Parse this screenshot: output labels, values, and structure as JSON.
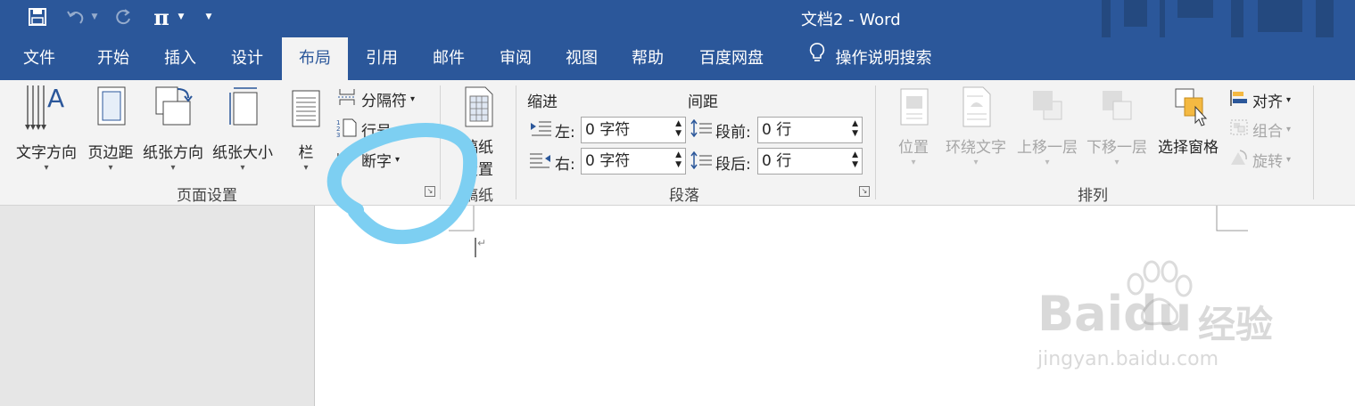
{
  "titlebar": {
    "doc_title": "文档2  -  Word"
  },
  "tabs": [
    "文件",
    "开始",
    "插入",
    "设计",
    "布局",
    "引用",
    "邮件",
    "审阅",
    "视图",
    "帮助",
    "百度网盘"
  ],
  "tell_me": "操作说明搜索",
  "ribbon": {
    "page_setup": {
      "text_direction": "文字方向",
      "margins": "页边距",
      "orientation": "纸张方向",
      "size": "纸张大小",
      "columns": "栏",
      "breaks": "分隔符",
      "line_numbers": "行号",
      "hyphenation": "断字",
      "group_label": "页面设置"
    },
    "manuscript": {
      "button_line1": "稿纸",
      "button_line2": "设置",
      "group_label": "稿纸"
    },
    "paragraph": {
      "indent_header": "缩进",
      "spacing_header": "间距",
      "left_label": "左:",
      "right_label": "右:",
      "before_label": "段前:",
      "after_label": "段后:",
      "left_value": "0 字符",
      "right_value": "0 字符",
      "before_value": "0 行",
      "after_value": "0 行",
      "group_label": "段落"
    },
    "arrange": {
      "position": "位置",
      "wrap_text": "环绕文字",
      "bring_forward": "上移一层",
      "send_backward": "下移一层",
      "selection_pane": "选择窗格",
      "align": "对齐",
      "group": "组合",
      "rotate": "旋转",
      "group_label": "排列"
    }
  },
  "colors": {
    "accent": "#2b579a",
    "highlight_circle": "#7dcff2"
  },
  "watermark": {
    "brand": "Baidu",
    "cn": "经验",
    "url": "jingyan.baidu.com"
  }
}
